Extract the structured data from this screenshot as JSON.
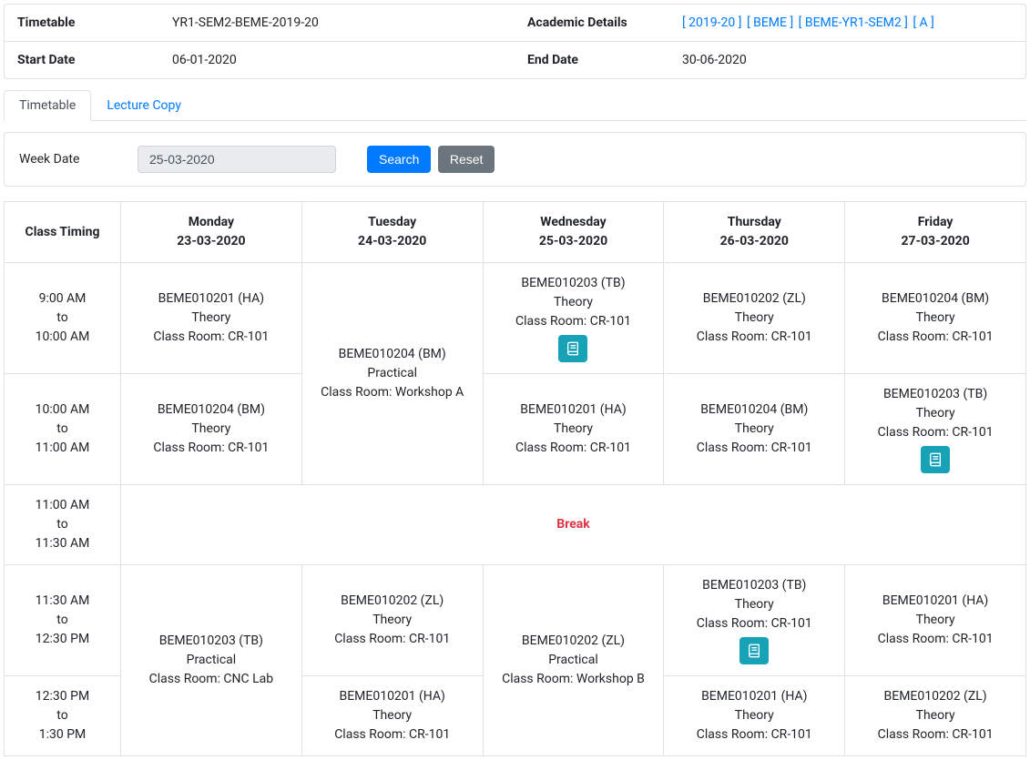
{
  "info": {
    "timetable_label": "Timetable",
    "timetable_value": "YR1-SEM2-BEME-2019-20",
    "academic_label": "Academic Details",
    "academic_links": [
      "[ 2019-20 ]",
      "[ BEME ]",
      "[ BEME-YR1-SEM2 ]",
      "[ A ]"
    ],
    "start_label": "Start Date",
    "start_value": "06-01-2020",
    "end_label": "End Date",
    "end_value": "30-06-2020"
  },
  "tabs": {
    "active": "Timetable",
    "other": "Lecture Copy"
  },
  "search": {
    "label": "Week Date",
    "value": "25-03-2020",
    "search_btn": "Search",
    "reset_btn": "Reset"
  },
  "tt": {
    "head": {
      "timing": "Class Timing",
      "days": [
        {
          "name": "Monday",
          "date": "23-03-2020"
        },
        {
          "name": "Tuesday",
          "date": "24-03-2020"
        },
        {
          "name": "Wednesday",
          "date": "25-03-2020"
        },
        {
          "name": "Thursday",
          "date": "26-03-2020"
        },
        {
          "name": "Friday",
          "date": "27-03-2020"
        }
      ]
    },
    "timings": [
      {
        "from": "9:00 AM",
        "to": "10:00 AM"
      },
      {
        "from": "10:00 AM",
        "to": "11:00 AM"
      },
      {
        "from": "11:00 AM",
        "to": "11:30 AM"
      },
      {
        "from": "11:30 AM",
        "to": "12:30 PM"
      },
      {
        "from": "12:30 PM",
        "to": "1:30 PM"
      }
    ],
    "break": "Break",
    "to": "to",
    "cells": {
      "mon_r1": {
        "l1": "BEME010201 (HA)",
        "l2": "Theory",
        "l3": "Class Room: CR-101"
      },
      "mon_r2": {
        "l1": "BEME010204 (BM)",
        "l2": "Theory",
        "l3": "Class Room: CR-101"
      },
      "mon_r45": {
        "l1": "BEME010203 (TB)",
        "l2": "Practical",
        "l3": "Class Room: CNC Lab"
      },
      "tue_r12": {
        "l1": "BEME010204 (BM)",
        "l2": "Practical",
        "l3": "Class Room: Workshop A"
      },
      "tue_r4": {
        "l1": "BEME010202 (ZL)",
        "l2": "Theory",
        "l3": "Class Room: CR-101"
      },
      "tue_r5": {
        "l1": "BEME010201 (HA)",
        "l2": "Theory",
        "l3": "Class Room: CR-101"
      },
      "wed_r1": {
        "l1": "BEME010203 (TB)",
        "l2": "Theory",
        "l3": "Class Room: CR-101"
      },
      "wed_r2": {
        "l1": "BEME010201 (HA)",
        "l2": "Theory",
        "l3": "Class Room: CR-101"
      },
      "wed_r45": {
        "l1": "BEME010202 (ZL)",
        "l2": "Practical",
        "l3": "Class Room: Workshop B"
      },
      "thu_r1": {
        "l1": "BEME010202 (ZL)",
        "l2": "Theory",
        "l3": "Class Room: CR-101"
      },
      "thu_r2": {
        "l1": "BEME010204 (BM)",
        "l2": "Theory",
        "l3": "Class Room: CR-101"
      },
      "thu_r4": {
        "l1": "BEME010203 (TB)",
        "l2": "Theory",
        "l3": "Class Room: CR-101"
      },
      "thu_r5": {
        "l1": "BEME010201 (HA)",
        "l2": "Theory",
        "l3": "Class Room: CR-101"
      },
      "fri_r1": {
        "l1": "BEME010204 (BM)",
        "l2": "Theory",
        "l3": "Class Room: CR-101"
      },
      "fri_r2": {
        "l1": "BEME010203 (TB)",
        "l2": "Theory",
        "l3": "Class Room: CR-101"
      },
      "fri_r4": {
        "l1": "BEME010201 (HA)",
        "l2": "Theory",
        "l3": "Class Room: CR-101"
      },
      "fri_r5": {
        "l1": "BEME010202 (ZL)",
        "l2": "Theory",
        "l3": "Class Room: CR-101"
      }
    }
  }
}
